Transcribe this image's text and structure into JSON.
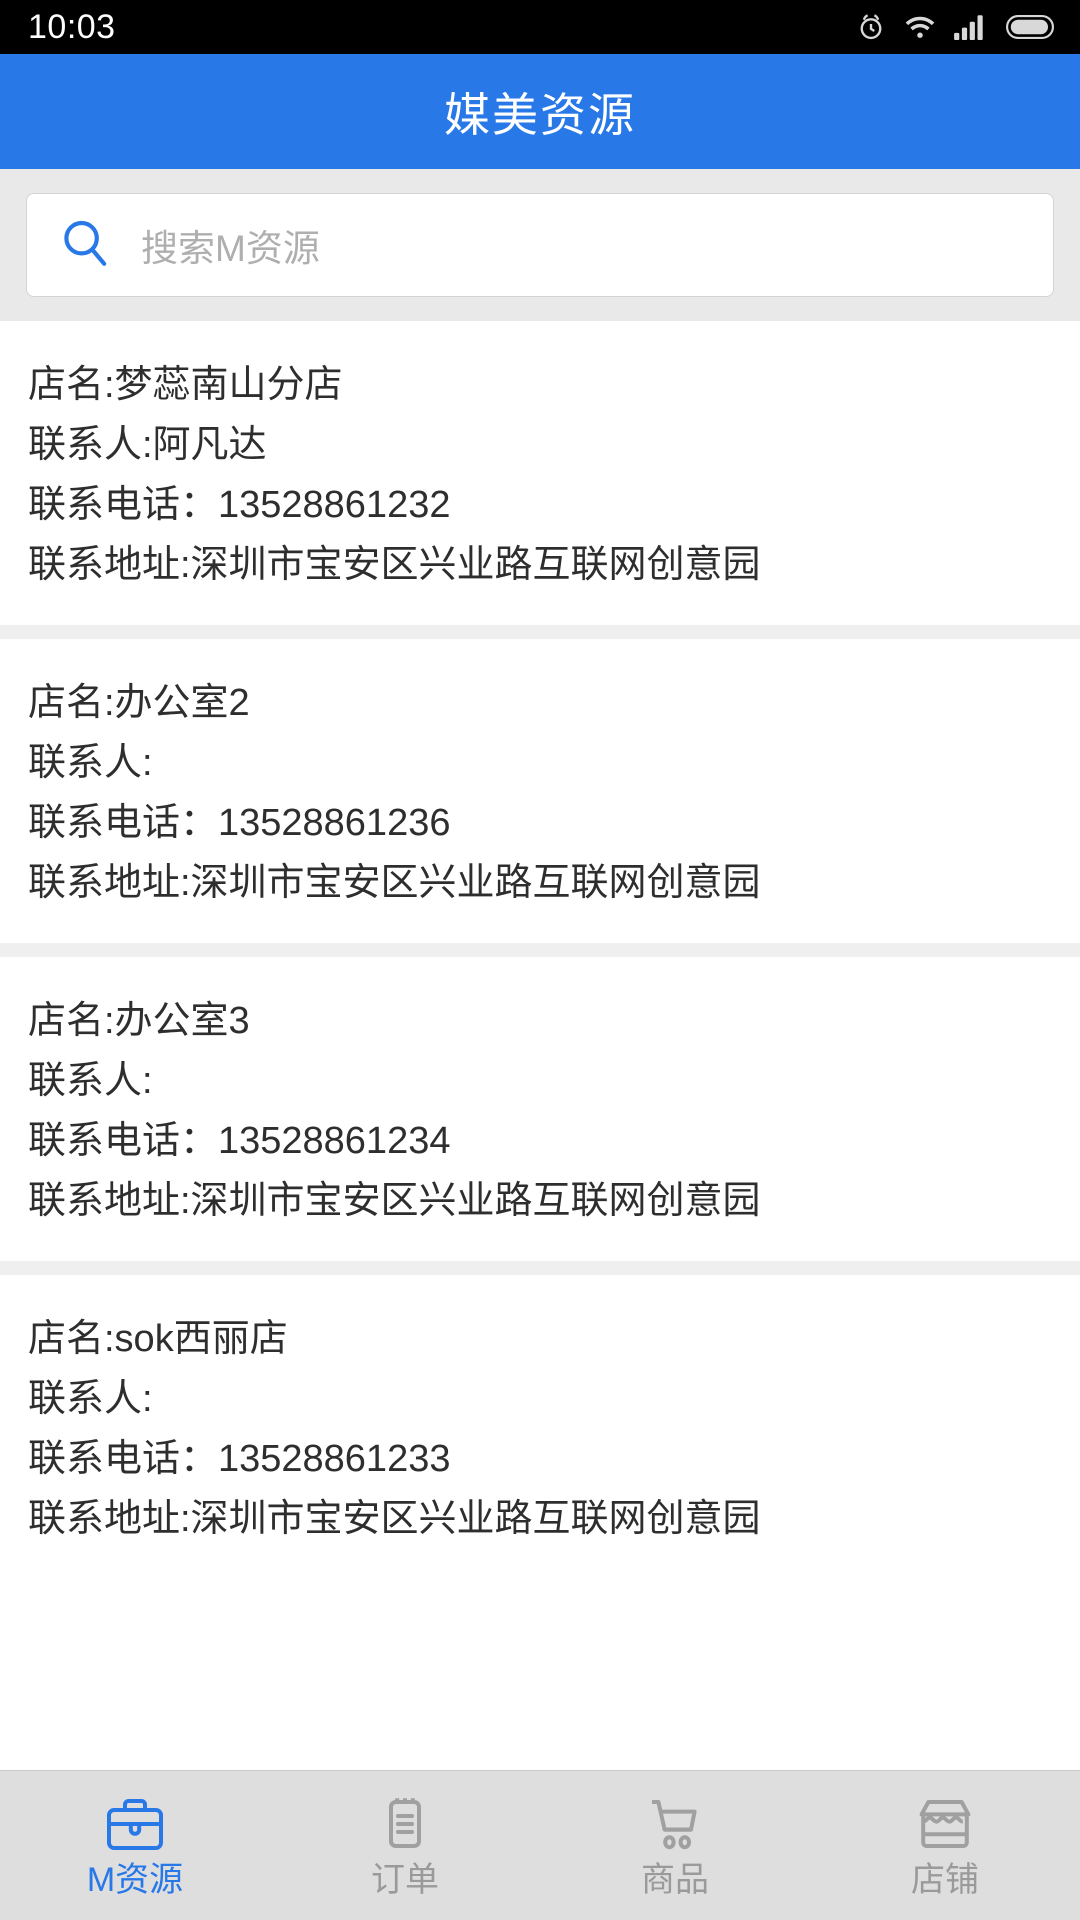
{
  "status_bar": {
    "time": "10:03",
    "icons": [
      "alarm-icon",
      "wifi-icon",
      "signal-icon",
      "battery-icon"
    ]
  },
  "header": {
    "title": "媒美资源",
    "background_color": "#2878E8",
    "text_color": "#FFFFFF"
  },
  "search": {
    "placeholder": "搜索M资源",
    "icon": "search-icon",
    "icon_color": "#2878E8"
  },
  "list": {
    "items": [
      {
        "shop_name": "店名:梦蕊南山分店",
        "contact": "联系人:阿凡达",
        "phone": "联系电话：13528861232",
        "address": "联系地址:深圳市宝安区兴业路互联网创意园"
      },
      {
        "shop_name": "店名:办公室2",
        "contact": "联系人:",
        "phone": "联系电话：13528861236",
        "address": "联系地址:深圳市宝安区兴业路互联网创意园"
      },
      {
        "shop_name": "店名:办公室3",
        "contact": "联系人:",
        "phone": "联系电话：13528861234",
        "address": "联系地址:深圳市宝安区兴业路互联网创意园"
      },
      {
        "shop_name": "店名:sok西丽店",
        "contact": "联系人:",
        "phone": "联系电话：13528861233",
        "address": "联系地址:深圳市宝安区兴业路互联网创意园"
      }
    ]
  },
  "tabbar": {
    "active_color": "#2878E8",
    "inactive_color": "#9A9A9A",
    "tabs": [
      {
        "label": "M资源",
        "icon": "briefcase-icon",
        "active": true
      },
      {
        "label": "订单",
        "icon": "order-list-icon",
        "active": false
      },
      {
        "label": "商品",
        "icon": "shopping-cart-icon",
        "active": false
      },
      {
        "label": "店铺",
        "icon": "store-icon",
        "active": false
      }
    ]
  }
}
